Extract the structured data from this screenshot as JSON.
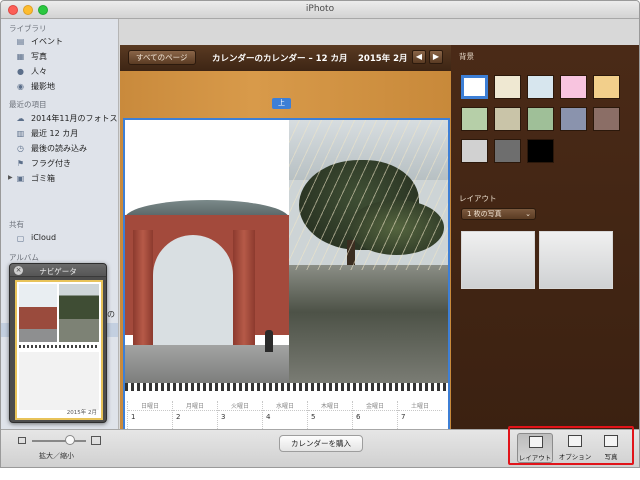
{
  "window": {
    "title": "iPhoto"
  },
  "sidebar": {
    "library_header": "ライブラリ",
    "library_items": [
      {
        "label": "イベント",
        "icon": "events-icon"
      },
      {
        "label": "写真",
        "icon": "photos-icon"
      },
      {
        "label": "人々",
        "icon": "people-icon"
      },
      {
        "label": "撮影地",
        "icon": "places-icon"
      }
    ],
    "recent_header": "最近の項目",
    "recent_items": [
      {
        "label": "2014年11月のフォトス…",
        "icon": "photostream-icon"
      },
      {
        "label": "最近 12 カ月",
        "icon": "calendar-icon"
      },
      {
        "label": "最後の読み込み",
        "icon": "import-icon"
      },
      {
        "label": "フラグ付き",
        "icon": "flag-icon"
      },
      {
        "label": "ゴミ箱",
        "icon": "trash-icon"
      }
    ],
    "shared_header": "共有",
    "shared_items": [
      {
        "label": "iCloud",
        "icon": "icloud-icon"
      }
    ],
    "albums_header": "アルバム",
    "partial_label": "の"
  },
  "navigator": {
    "title": "ナビゲータ",
    "date": "2015年 2月"
  },
  "toolbar": {
    "all_pages": "すべてのページ",
    "calendar_title": "カレンダーのカレンダー – 12 カ月",
    "month": "2015年 2月",
    "prev": "◀",
    "next": "▶"
  },
  "canvas": {
    "page_tag": "上",
    "days": [
      {
        "name": "日曜日",
        "value": "1"
      },
      {
        "name": "月曜日",
        "value": "2"
      },
      {
        "name": "火曜日",
        "value": "3"
      },
      {
        "name": "水曜日",
        "value": "4"
      },
      {
        "name": "木曜日",
        "value": "5"
      },
      {
        "name": "金曜日",
        "value": "6"
      },
      {
        "name": "土曜日",
        "value": "7"
      }
    ]
  },
  "inspector": {
    "background_label": "背景",
    "swatches": [
      "#ffffff",
      "#efe8d2",
      "#d7e6ee",
      "#f8c4df",
      "#f2cf8b",
      "#b6cfa8",
      "#c9c4a8",
      "#9fbf98",
      "#8a93ad",
      "#8b6e66",
      "#d1d1d1",
      "#6e6e6e",
      "#000000"
    ],
    "layout_label": "レイアウト",
    "layout_select": "1 枚の写真"
  },
  "bottombar": {
    "zoom_label": "拡大／縮小",
    "buy_button": "カレンダーを購入",
    "tools": [
      {
        "label": "レイアウト",
        "icon": "layout-icon",
        "active": true
      },
      {
        "label": "オプション",
        "icon": "options-icon",
        "active": false
      },
      {
        "label": "写真",
        "icon": "photos-panel-icon",
        "active": false
      }
    ]
  },
  "colors": {
    "accent": "#3d7fd6",
    "highlight_box": "#e1141a"
  }
}
